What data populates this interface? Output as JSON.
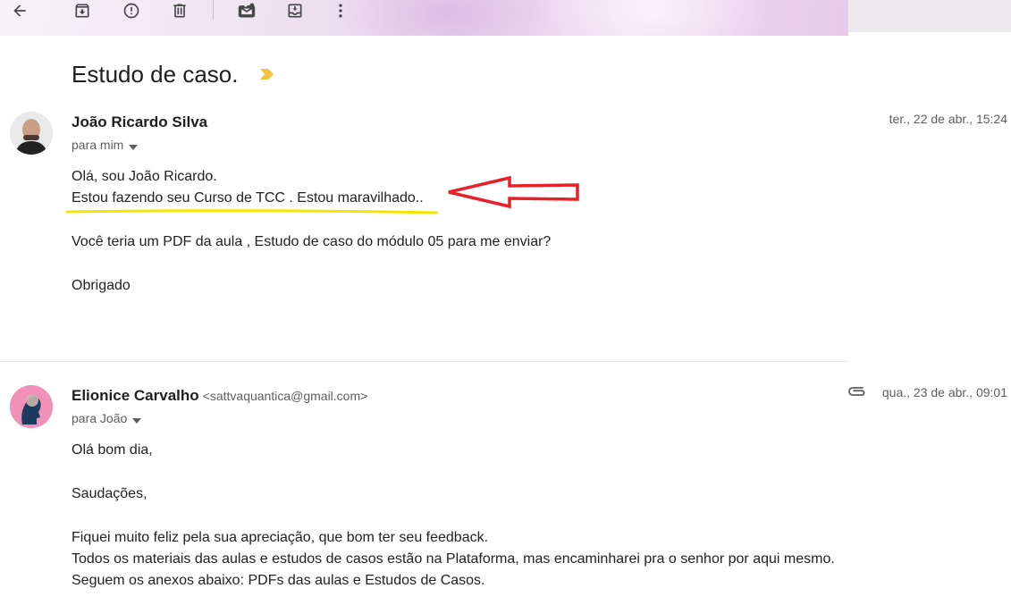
{
  "toolbar": {
    "icons": [
      "back-arrow-icon",
      "archive-icon",
      "report-spam-icon",
      "delete-icon",
      "mark-unread-icon",
      "move-to-icon",
      "more-vert-icon"
    ]
  },
  "thread": {
    "subject": "Estudo de caso."
  },
  "messages": [
    {
      "sender_name": "João Ricardo Silva",
      "sender_email": "",
      "recipient_label": "para mim",
      "date": "ter., 22 de abr., 15:24",
      "body": [
        "Olá, sou João Ricardo.",
        "Estou fazendo seu Curso de TCC . Estou maravilhado..",
        "Você teria um PDF da aula  , Estudo de caso do módulo 05 para me enviar?",
        "Obrigado"
      ]
    },
    {
      "sender_name": "Elionice Carvalho",
      "sender_email": "<sattvaquantica@gmail.com>",
      "recipient_label": "para João",
      "date": "qua., 23 de abr., 09:01",
      "has_attachment": true,
      "body": [
        "Olá bom dia,",
        "Saudações,",
        "Fiquei muito feliz pela sua apreciação, que bom ter seu feedback.",
        "Todos os materiais das aulas e estudos de casos estão na Plataforma, mas encaminharei pra o senhor por aqui mesmo.",
        "Seguem os anexos abaixo: PDFs das aulas e Estudos de Casos."
      ]
    }
  ],
  "colors": {
    "annotation_arrow": "#e8202a",
    "annotation_underline": "#f5e400",
    "importance_marker": "#f5c242"
  }
}
